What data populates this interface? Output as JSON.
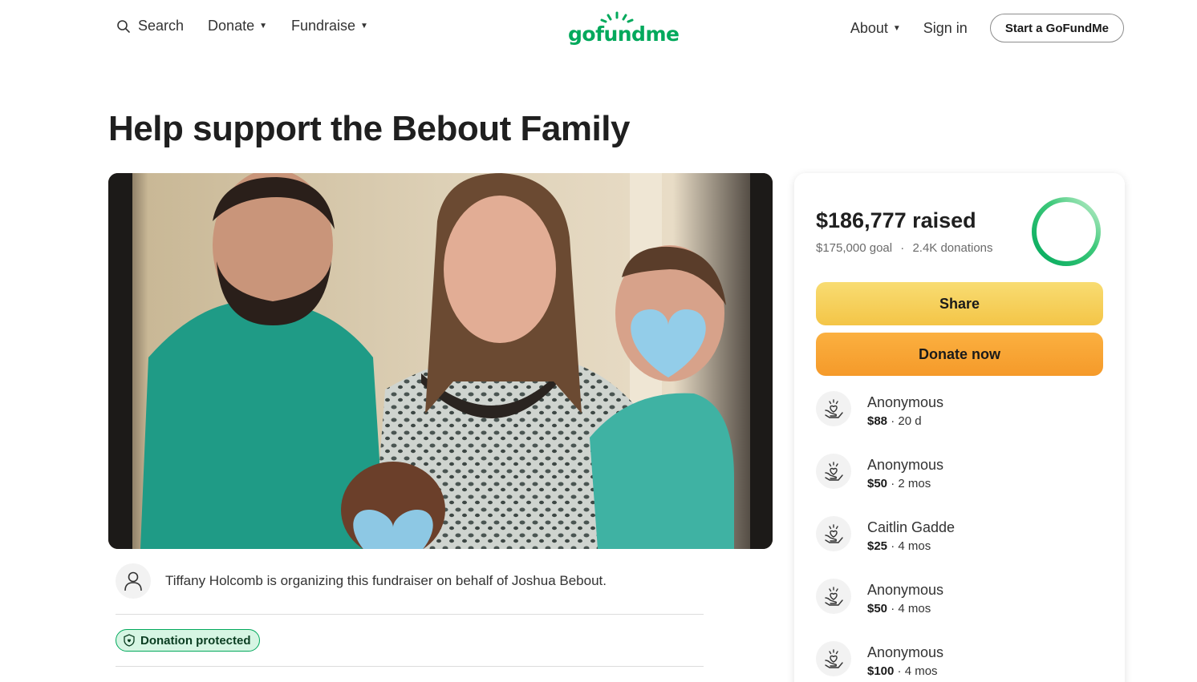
{
  "header": {
    "search_label": "Search",
    "donate_label": "Donate",
    "fundraise_label": "Fundraise",
    "logo_text": "gofundme",
    "about_label": "About",
    "signin_label": "Sign in",
    "start_label": "Start a GoFundMe",
    "brand_color": "#02a95c"
  },
  "page": {
    "title": "Help support the Bebout Family"
  },
  "organizer": {
    "text": "Tiffany Holcomb is organizing this fundraiser on behalf of Joshua Bebout."
  },
  "protection": {
    "badge": "Donation protected"
  },
  "panel": {
    "raised": "$186,777 raised",
    "goal": "$175,000 goal",
    "separator": "·",
    "donations_count": "2.4K donations",
    "progress_fraction": 1.0,
    "share_label": "Share",
    "donate_label": "Donate now",
    "share_color": "#f4c547",
    "donate_color": "#f59a2a"
  },
  "donations": [
    {
      "name": "Anonymous",
      "amount": "$88",
      "age": " · 20 d"
    },
    {
      "name": "Anonymous",
      "amount": "$50",
      "age": " · 2 mos"
    },
    {
      "name": "Caitlin Gadde",
      "amount": "$25",
      "age": " · 4 mos"
    },
    {
      "name": "Anonymous",
      "amount": "$50",
      "age": " · 4 mos"
    },
    {
      "name": "Anonymous",
      "amount": "$100",
      "age": " · 4 mos"
    }
  ]
}
